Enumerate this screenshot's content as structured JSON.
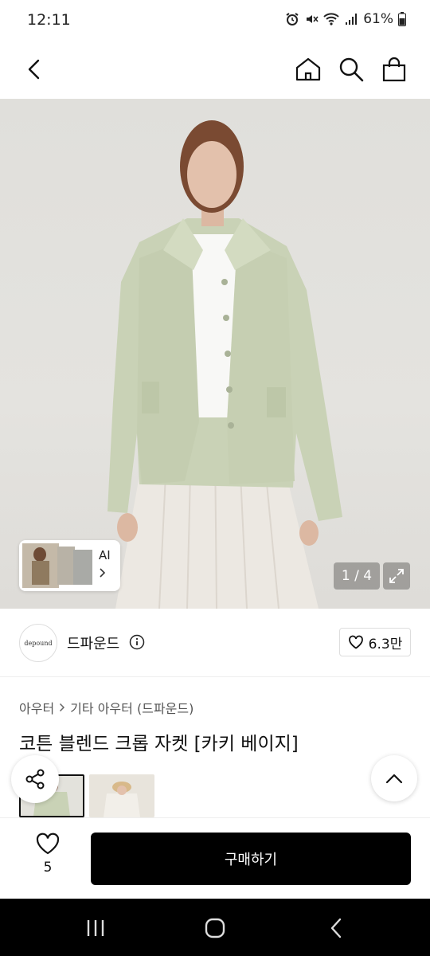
{
  "status_bar": {
    "time": "12:11",
    "battery": "61%"
  },
  "gallery": {
    "counter": "1 / 4",
    "ai_label": "AI"
  },
  "brand": {
    "logo_text": "depound",
    "name": "드파운드",
    "likes": "6.3만"
  },
  "product": {
    "breadcrumb": [
      "아우터",
      "기타 아우터 (드파운드)"
    ],
    "title": "코튼 블렌드 크롭 자켓 [카키 베이지]"
  },
  "bottom": {
    "wish_count": "5",
    "buy_label": "구매하기"
  },
  "colors": {
    "accent": "#000000",
    "jacket": "#c9d2b6",
    "background": "#e2e1dd"
  }
}
